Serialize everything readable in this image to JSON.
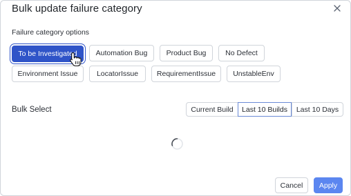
{
  "dialog": {
    "title": "Bulk update failure category",
    "close_icon": "close-icon"
  },
  "failure_category": {
    "label": "Failure category options",
    "options": [
      "To be Investigated",
      "Automation Bug",
      "Product Bug",
      "No Defect",
      "Environment Issue",
      "LocatorIssue",
      "RequirementIssue",
      "UnstableEnv"
    ],
    "selected": "To be Investigated"
  },
  "bulk_select": {
    "label": "Bulk Select",
    "options": [
      "Current Build",
      "Last 10 Builds",
      "Last 10 Days"
    ],
    "selected": "Last 10 Builds"
  },
  "loading": {
    "icon": "spinner-icon"
  },
  "footer": {
    "cancel_label": "Cancel",
    "apply_label": "Apply"
  },
  "colors": {
    "primary": "#2f54c8",
    "apply_disabled": "#5b86f0",
    "border": "#d0d4da",
    "segment_active_border": "#6a8ad6"
  }
}
